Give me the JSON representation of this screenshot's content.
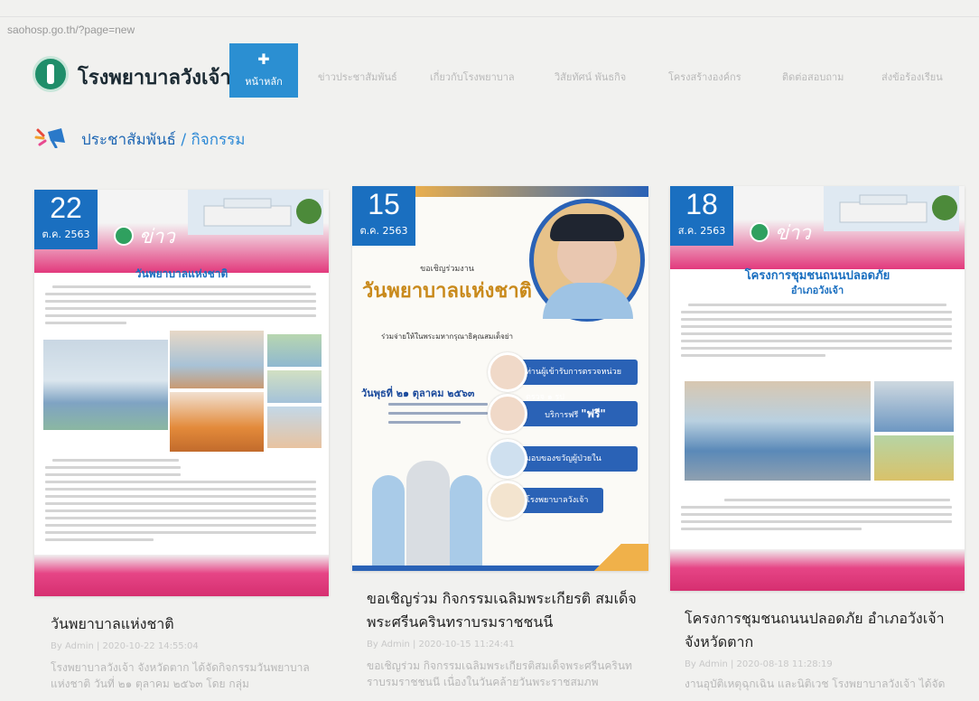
{
  "browser": {
    "url": "saohosp.go.th/?page=new"
  },
  "header": {
    "site_title": "โรงพยาบาลวังเจ้า",
    "nav": {
      "home": "หน้าหลัก",
      "items": [
        "ข่าวประชาสัมพันธ์",
        "เกี่ยวกับโรงพยาบาล",
        "วิสัยทัศน์ พันธกิจ",
        "โครงสร้างองค์กร",
        "ติดต่อสอบถาม",
        "ส่งข้อร้องเรียน"
      ]
    }
  },
  "section": {
    "title": "ประชาสัมพันธ์",
    "separator": "/",
    "subtitle": "กิจกรรม"
  },
  "colors": {
    "accent": "#2b8fd2",
    "brand_pink": "#e2397c",
    "badge_blue": "#1a6fc0"
  },
  "cards": [
    {
      "day": "22",
      "month": "ต.ค. 2563",
      "banner_word": "ข่าว",
      "image_heading": "วันพยาบาลแห่งชาติ",
      "title": "วันพยาบาลแห่งชาติ",
      "meta": "By Admin | 2020-10-22 14:55:04",
      "excerpt": "โรงพยาบาลวังเจ้า จังหวัดตาก ได้จัดกิจกรรมวันพยาบาลแห่งชาติ วันที่ ๒๑ ตุลาคม ๒๕๖๓ โดย กลุ่ม"
    },
    {
      "day": "15",
      "month": "ต.ค. 2563",
      "image_kicker": "ขอเชิญร่วมงาน",
      "image_heading": "วันพยาบาลแห่งชาติ",
      "image_sub": "ร่วมจ่ายให้ในพระมหากรุณาธิคุณสมเด็จย่า",
      "image_date": "วันพุธที่ ๒๑ ตุลาคม ๒๕๖๓",
      "services": [
        "ท่านผู้เข้ารับการตรวจหน่วยตรวจ ๑ รูป",
        "บริการฟรี",
        "มอบของขวัญผู้ป่วยใน",
        "โรงพยาบาลวังเจ้า"
      ],
      "service_free_label": "\"ฟรี\"",
      "title": "ขอเชิญร่วม กิจกรรมเฉลิมพระเกียรติ สมเด็จพระศรีนครินทราบรมราชชนนี",
      "meta": "By Admin | 2020-10-15 11:24:41",
      "excerpt": "ขอเชิญร่วม กิจกรรมเฉลิมพระเกียรติสมเด็จพระศรีนครินทราบรมราชชนนี เนื่องในวันคล้ายวันพระราชสมภพ"
    },
    {
      "day": "18",
      "month": "ส.ค. 2563",
      "banner_word": "ข่าว",
      "image_heading": "โครงการชุมชนถนนปลอดภัย",
      "image_sub": "อำเภอวังเจ้า",
      "title": "โครงการชุมชนถนนปลอดภัย อำเภอวังเจ้า จังหวัดตาก",
      "meta": "By Admin | 2020-08-18 11:28:19",
      "excerpt": "งานอุบัติเหตุฉุกเฉิน และนิติเวช โรงพยาบาลวังเจ้า ได้จัด"
    }
  ]
}
